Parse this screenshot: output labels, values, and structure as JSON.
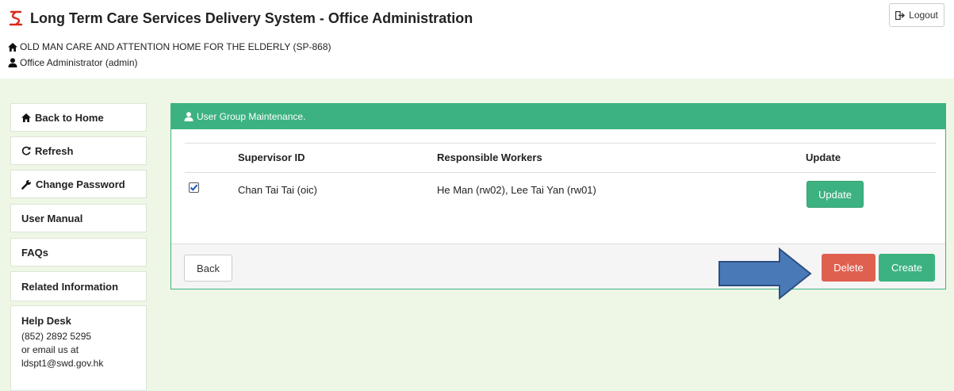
{
  "header": {
    "title": "Long Term Care Services Delivery System - Office Administration",
    "organization": "OLD MAN CARE AND ATTENTION HOME FOR THE ELDERLY (SP-868)",
    "user": "Office Administrator (admin)",
    "logout_label": "Logout"
  },
  "sidebar": {
    "items": [
      {
        "label": "Back to Home",
        "icon": "home-icon"
      },
      {
        "label": "Refresh",
        "icon": "refresh-icon"
      },
      {
        "label": "Change Password",
        "icon": "wrench-icon"
      },
      {
        "label": "User Manual"
      },
      {
        "label": "FAQs"
      },
      {
        "label": "Related Information"
      }
    ],
    "helpdesk": {
      "title": "Help Desk",
      "phone": "(852) 2892 5295",
      "email_prefix": "or email us at",
      "email": "ldspt1@swd.gov.hk"
    }
  },
  "panel": {
    "title": "User Group Maintenance.",
    "columns": [
      "Supervisor ID",
      "Responsible Workers",
      "Update"
    ],
    "rows": [
      {
        "checked": true,
        "supervisor": "Chan Tai Tai (oic)",
        "workers": "He Man (rw02), Lee Tai Yan (rw01)",
        "update_label": "Update"
      }
    ],
    "back_label": "Back",
    "delete_label": "Delete",
    "create_label": "Create"
  },
  "colors": {
    "accent_green": "#3cb280",
    "danger_red": "#e06050",
    "page_background": "#eef7e6",
    "logo_red": "#d9291c",
    "annotation_arrow": "#4a79b8"
  }
}
